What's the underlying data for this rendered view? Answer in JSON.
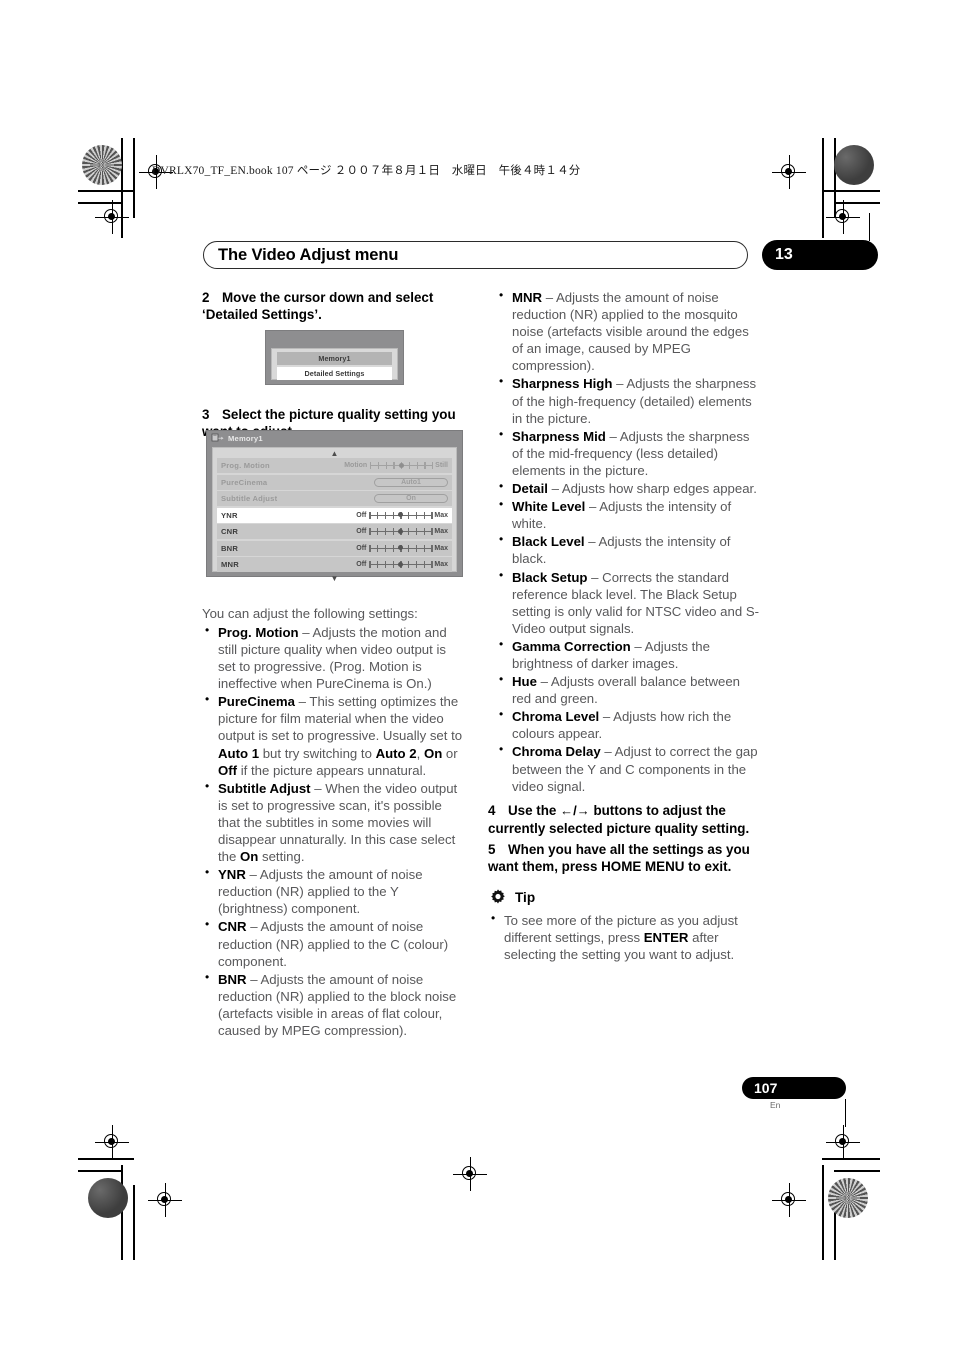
{
  "meta": {
    "header_line": "DVRLX70_TF_EN.book   107 ページ   ２００７年８月１日　水曜日　午後４時１４分"
  },
  "header": {
    "title": "The Video Adjust menu",
    "chapter_number": "13"
  },
  "footer": {
    "page_number": "107",
    "language": "En"
  },
  "left_column": {
    "step2": {
      "num": "2",
      "text": "Move the cursor down and select ‘Detailed Settings’."
    },
    "figure_small": {
      "rows": [
        {
          "label": "Memory1",
          "state": "selected"
        },
        {
          "label": "Detailed Settings",
          "state": "highlighted"
        }
      ]
    },
    "step3": {
      "num": "3",
      "text": "Select the picture quality setting you want to adjust."
    },
    "figure_big": {
      "title": "Memory1",
      "icon": "memory-card-icon",
      "scroll_up": "▲",
      "scroll_down": "▼",
      "rows": [
        {
          "name": "Prog. Motion",
          "control": "slider",
          "left": "Motion",
          "right": "Still",
          "knob": 4,
          "ticks": 9,
          "dim": true
        },
        {
          "name": "PureCinema",
          "control": "pill",
          "value": "Auto1",
          "dim": true
        },
        {
          "name": "Subtitle Adjust",
          "control": "pill",
          "value": "On",
          "dim": true
        },
        {
          "name": "YNR",
          "control": "slider",
          "left": "Off",
          "right": "Max",
          "knob": 4,
          "ticks": 9,
          "dim": false,
          "highlight": true
        },
        {
          "name": "CNR",
          "control": "slider",
          "left": "Off",
          "right": "Max",
          "knob": 4,
          "ticks": 9,
          "dim": false
        },
        {
          "name": "BNR",
          "control": "slider",
          "left": "Off",
          "right": "Max",
          "knob": 4,
          "ticks": 9,
          "dim": false
        },
        {
          "name": "MNR",
          "control": "slider",
          "left": "Off",
          "right": "Max",
          "knob": 4,
          "ticks": 9,
          "dim": false
        }
      ]
    },
    "intro": "You can adjust the following settings:",
    "bullets": [
      {
        "term": "Prog. Motion",
        "dash": " – ",
        "body": "Adjusts the motion and still picture quality when video output is set to progressive. (Prog. Motion is ineffective when PureCinema is On.)"
      },
      {
        "term": "PureCinema",
        "dash": " – ",
        "body_parts": [
          {
            "t": "This setting optimizes the picture for film material when the video output is set to progressive. Usually set to ",
            "b": false
          },
          {
            "t": "Auto 1",
            "b": true
          },
          {
            "t": " but try switching to ",
            "b": false
          },
          {
            "t": "Auto 2",
            "b": true
          },
          {
            "t": ", ",
            "b": false
          },
          {
            "t": "On",
            "b": true
          },
          {
            "t": " or ",
            "b": false
          },
          {
            "t": "Off",
            "b": true
          },
          {
            "t": " if the picture appears unnatural.",
            "b": false
          }
        ]
      },
      {
        "term": "Subtitle Adjust",
        "dash": " – ",
        "body_parts": [
          {
            "t": "When the video output is set to progressive scan, it's possible that the subtitles in some movies will disappear unnaturally. In this case select the ",
            "b": false
          },
          {
            "t": "On",
            "b": true
          },
          {
            "t": " setting.",
            "b": false
          }
        ]
      },
      {
        "term": "YNR",
        "dash": " – ",
        "body": "Adjusts the amount of noise reduction (NR) applied to the Y (brightness) component."
      },
      {
        "term": "CNR",
        "dash": " – ",
        "body": "Adjusts the amount of noise reduction (NR) applied to the C (colour) component."
      },
      {
        "term": "BNR",
        "dash": " – ",
        "body": "Adjusts the amount of noise reduction (NR) applied to the block noise (artefacts visible in areas of flat colour, caused by MPEG compression)."
      }
    ]
  },
  "right_column": {
    "bullets": [
      {
        "term": "MNR",
        "dash": " – ",
        "body": "Adjusts the amount of noise reduction (NR) applied to the mosquito noise (artefacts visible around the edges of an image, caused by MPEG compression)."
      },
      {
        "term": "Sharpness High",
        "dash": " – ",
        "body": "Adjusts the sharpness of the high-frequency (detailed) elements in the picture."
      },
      {
        "term": "Sharpness Mid",
        "dash": " – ",
        "body": "Adjusts the sharpness of the mid-frequency (less detailed) elements in the picture."
      },
      {
        "term": "Detail",
        "dash": " – ",
        "body": "Adjusts how sharp edges appear."
      },
      {
        "term": "White Level",
        "dash": " – ",
        "body": "Adjusts the intensity of white."
      },
      {
        "term": "Black Level",
        "dash": " – ",
        "body": "Adjusts the intensity of black."
      },
      {
        "term": "Black Setup",
        "dash": " – ",
        "body": "Corrects the standard reference black level. The Black Setup setting is only valid for NTSC video and S-Video output signals."
      },
      {
        "term": "Gamma Correction",
        "dash": " – ",
        "body": "Adjusts the brightness of darker images."
      },
      {
        "term": "Hue",
        "dash": " – ",
        "body": "Adjusts overall balance between red and green."
      },
      {
        "term": "Chroma Level",
        "dash": " – ",
        "body": "Adjusts how rich the colours appear."
      },
      {
        "term": "Chroma Delay",
        "dash": " – ",
        "body": "Adjust to correct the gap between the Y and C components in the video signal."
      }
    ],
    "step4": {
      "num": "4",
      "pre": "Use the ",
      "arrows": "←/→",
      "post": " buttons to adjust the currently selected picture quality setting."
    },
    "step5": {
      "num": "5",
      "text": "When you have all the settings as you want them, press HOME MENU to exit."
    },
    "tip": {
      "icon": "gear-icon",
      "label": "Tip",
      "bullet_parts": [
        {
          "t": "To see more of the picture as you adjust different settings, press ",
          "b": false
        },
        {
          "t": "ENTER",
          "b": true
        },
        {
          "t": " after selecting the setting you want to adjust.",
          "b": false
        }
      ]
    }
  },
  "colors": {
    "body_text": "#58585a",
    "heading": "#000000",
    "osd_panel": "#8e8e90",
    "osd_body": "#d6d6d6",
    "osd_row": "#c6c6c6",
    "osd_row_highlight": "#ffffff"
  }
}
